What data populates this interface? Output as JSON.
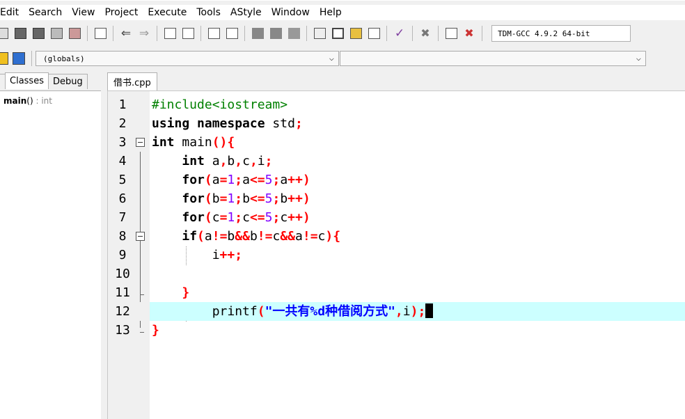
{
  "menu": [
    "Edit",
    "Search",
    "View",
    "Project",
    "Execute",
    "Tools",
    "AStyle",
    "Window",
    "Help"
  ],
  "toolbar": {
    "compiler": "TDM-GCC 4.9.2 64-bit"
  },
  "scope_bar": {
    "scope_value": "(globals)",
    "member_value": ""
  },
  "left_panel": {
    "tabs": [
      "Classes",
      "Debug"
    ],
    "tree": [
      {
        "name": "main",
        "sig": "()",
        "ret": ": int"
      }
    ]
  },
  "editor": {
    "file_tab": "借书.cpp",
    "lines": [
      "1",
      "2",
      "3",
      "4",
      "5",
      "6",
      "7",
      "8",
      "9",
      "10",
      "11",
      "12",
      "13"
    ]
  }
}
